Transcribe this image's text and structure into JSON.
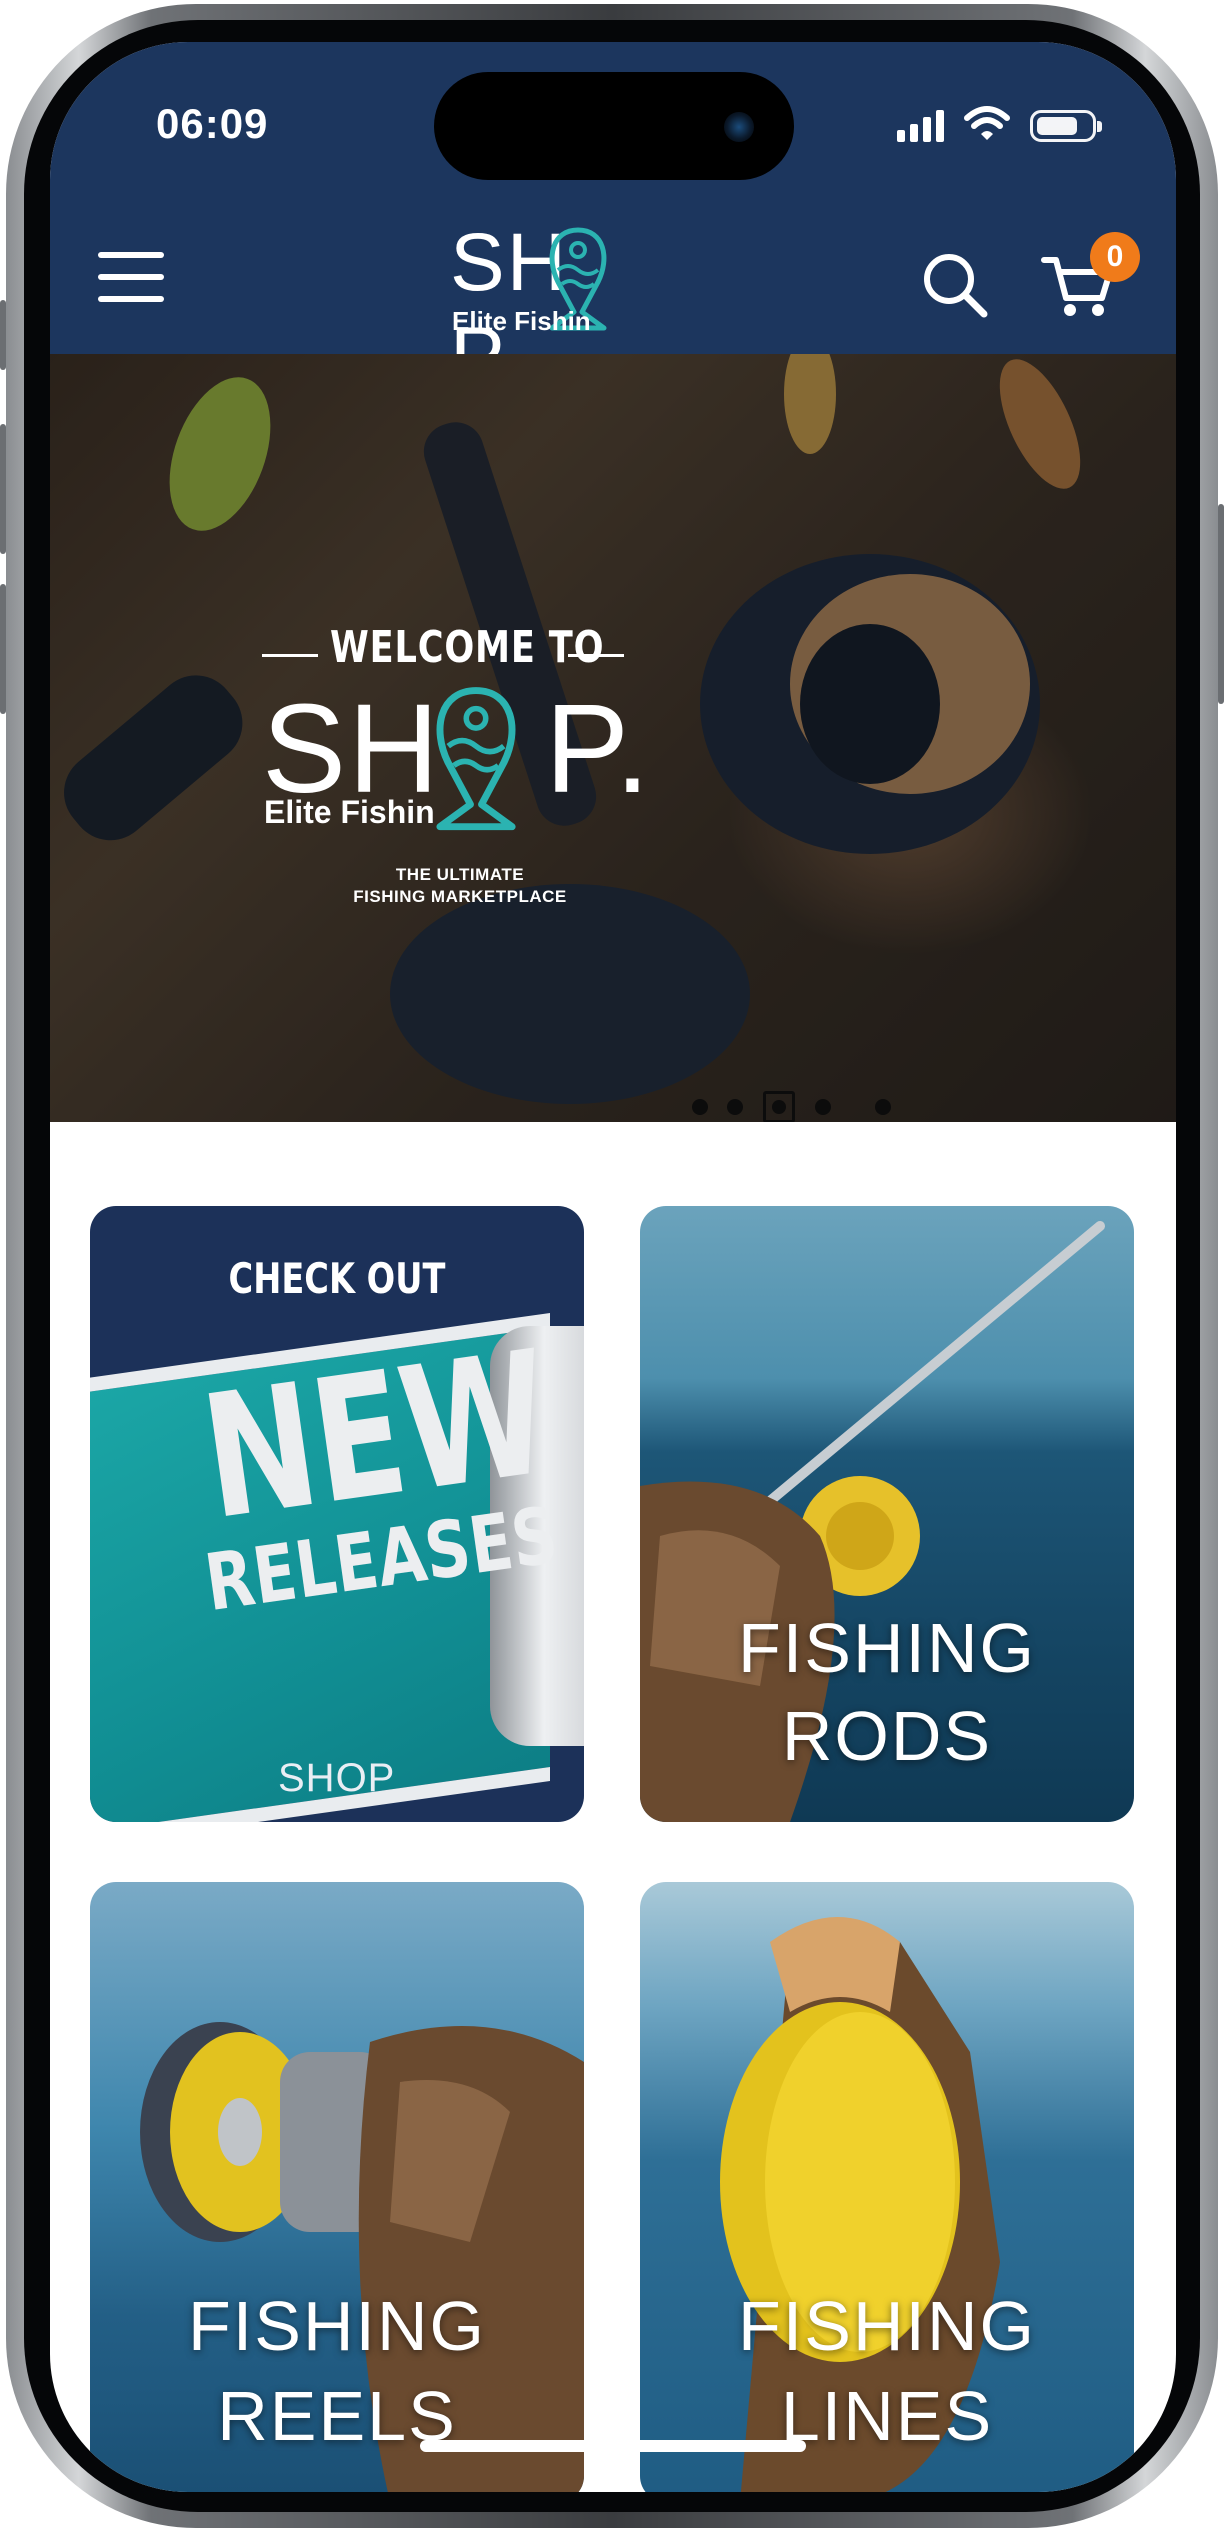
{
  "status_bar": {
    "time": "06:09"
  },
  "header": {
    "logo_text_left": "SH",
    "logo_text_right": "P.",
    "logo_sub": "Elite Fishin",
    "cart_count": "0"
  },
  "hero": {
    "welcome": "WELCOME TO",
    "logo_text_left": "SH",
    "logo_text_right": "P.",
    "logo_sub": "Elite Fishin",
    "tagline_1": "THE ULTIMATE",
    "tagline_2": "FISHING MARKETPLACE",
    "slide_count": 5,
    "active_slide": 3
  },
  "categories": [
    {
      "line1": "CHECK OUT",
      "line2": "NEW",
      "line3": "RELEASES",
      "logo": "SHOP"
    },
    {
      "line1": "FISHING",
      "line2": "RODS"
    },
    {
      "line1": "FISHING",
      "line2": "REELS"
    },
    {
      "line1": "FISHING",
      "line2": "LINES"
    }
  ],
  "colors": {
    "brand_navy": "#1c365e",
    "accent_teal": "#20a9a6",
    "badge_orange": "#f07b1a"
  },
  "icons": {
    "menu": "hamburger-icon",
    "search": "search-icon",
    "cart": "cart-icon"
  }
}
